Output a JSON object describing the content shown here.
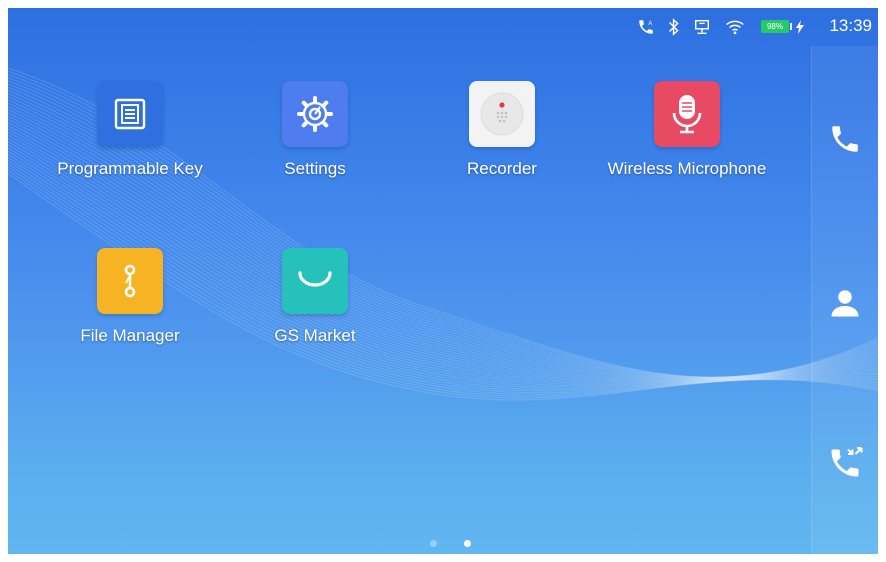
{
  "status_bar": {
    "time": "13:39",
    "battery_level": "98%",
    "icons": [
      "call-forward-icon",
      "bluetooth-icon",
      "network-icon",
      "wifi-icon",
      "battery-icon",
      "charging-icon"
    ]
  },
  "apps": [
    {
      "label": "Programmable Key",
      "icon": "keypad-list-icon",
      "color": "#2f6fdf"
    },
    {
      "label": "Settings",
      "icon": "gear-icon",
      "color": "#4e7df0"
    },
    {
      "label": "Recorder",
      "icon": "recorder-icon",
      "color": "#f3f3f3"
    },
    {
      "label": "Wireless Microphone",
      "icon": "microphone-icon",
      "color": "#e84a63"
    },
    {
      "label": "File Manager",
      "icon": "folder-zipper-icon",
      "color": "#f6b323"
    },
    {
      "label": "GS Market",
      "icon": "market-bag-icon",
      "color": "#27c1bc"
    }
  ],
  "dock": {
    "items": [
      "phone-icon",
      "contacts-icon",
      "call-history-icon"
    ]
  },
  "pagination": {
    "pages": 2,
    "current": 2
  },
  "colors": {
    "background_top": "#2d6fe0",
    "background_bottom": "#61b7f0",
    "battery": "#27c86a"
  }
}
